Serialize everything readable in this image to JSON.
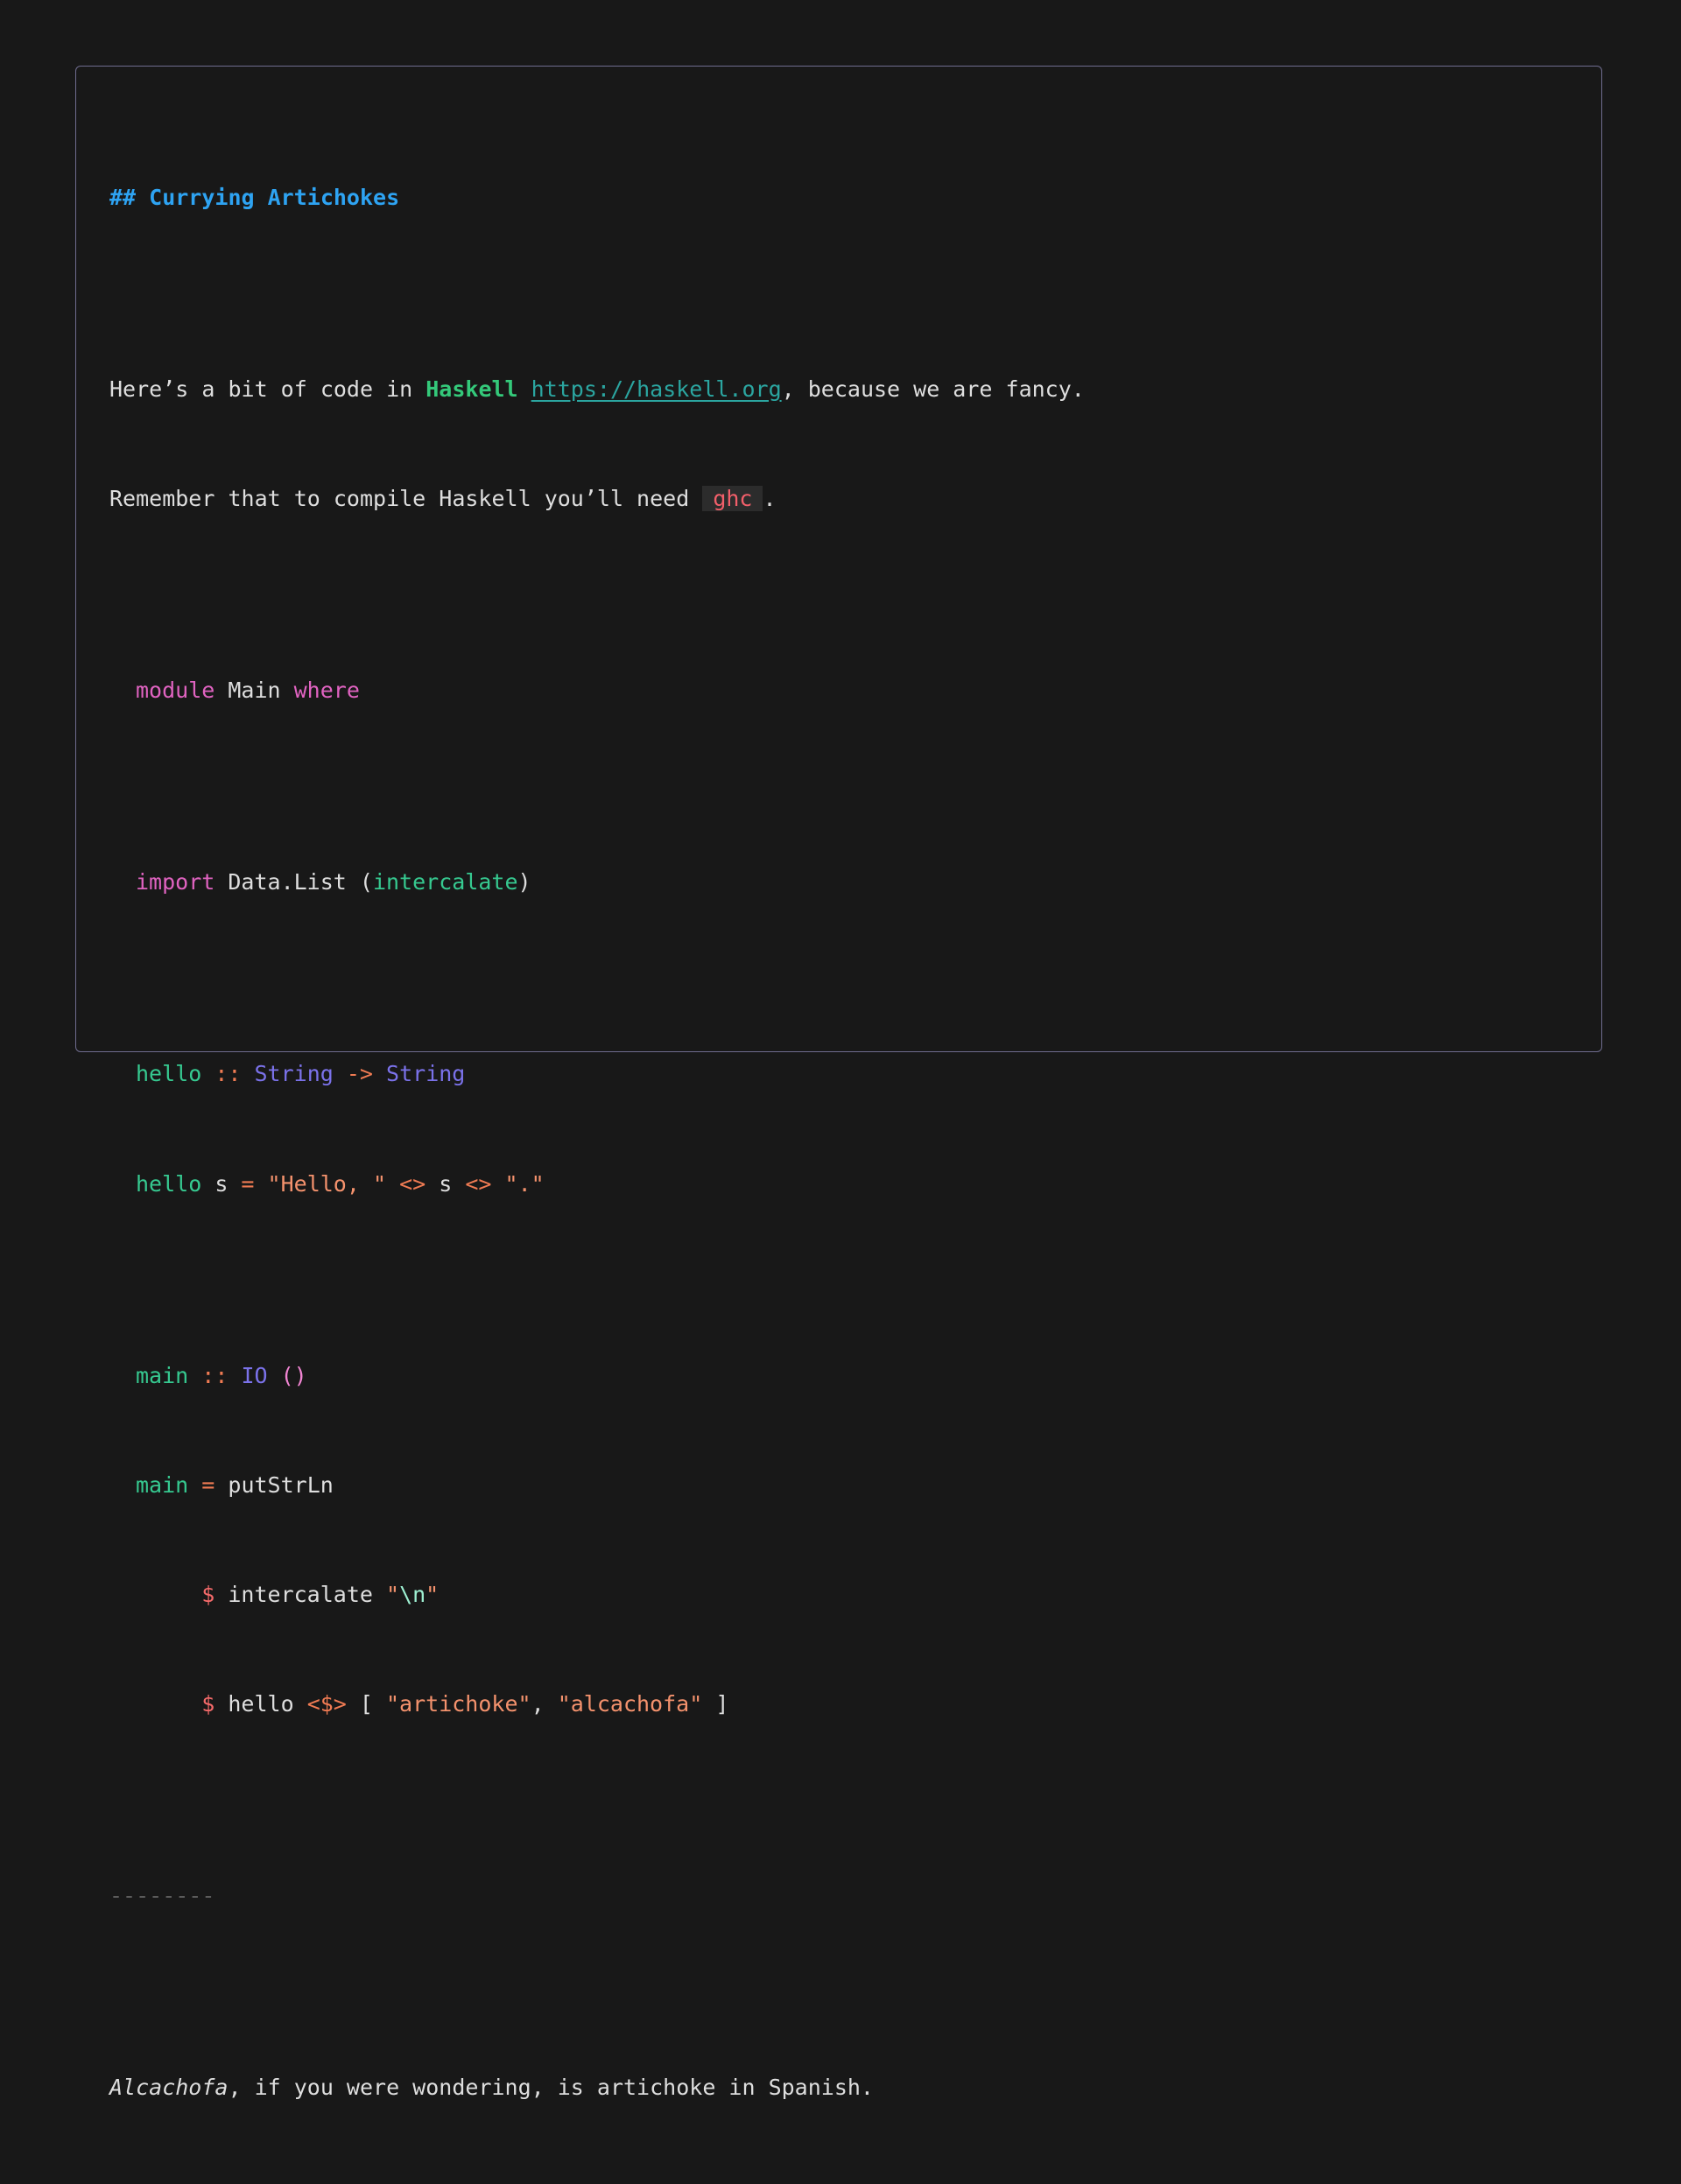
{
  "document": {
    "heading": "## Currying Artichokes",
    "intro": {
      "prefix": "Here’s a bit of code in ",
      "bold": "Haskell",
      "space": " ",
      "link": "https://haskell.org",
      "suffix": ", because we are fancy."
    },
    "intro2": {
      "prefix": "Remember that to compile Haskell you’ll need ",
      "code": "ghc",
      "suffix": "."
    },
    "code": {
      "l1": {
        "a": "module",
        "b": " Main ",
        "c": "where"
      },
      "l2": {
        "a": "import",
        "b": " Data.List (",
        "c": "intercalate",
        "d": ")"
      },
      "l3": {
        "a": "hello",
        "b": " ",
        "c": "::",
        "d": " ",
        "e": "String",
        "f": " ",
        "g": "->",
        "h": " ",
        "i": "String"
      },
      "l4": {
        "a": "hello",
        "b": " s ",
        "c": "=",
        "d": " ",
        "e": "\"Hello, \"",
        "f": " ",
        "g": "<>",
        "h": " s ",
        "i": "<>",
        "j": " ",
        "k": "\".\""
      },
      "l5": {
        "a": "main",
        "b": " ",
        "c": "::",
        "d": " ",
        "e": "IO",
        "f": " ",
        "g": "()"
      },
      "l6": {
        "a": "main",
        "b": " ",
        "c": "=",
        "d": " putStrLn"
      },
      "l7": {
        "indent": "     ",
        "a": "$",
        "b": " intercalate ",
        "c": "\"",
        "d": "\\n",
        "e": "\""
      },
      "l8": {
        "indent": "     ",
        "a": "$",
        "b": " hello ",
        "c": "<$>",
        "d": " [ ",
        "e": "\"artichoke\"",
        "f": ", ",
        "g": "\"alcachofa\"",
        "h": " ]"
      }
    },
    "rule": "--------",
    "outro": {
      "italic": "Alcachofa",
      "rest": ", if you were wondering, is artichoke in Spanish."
    }
  },
  "colors": {
    "background": "#181818",
    "border": "#6f6c8f",
    "heading": "#2ea3f2",
    "keyword": "#e063c1",
    "function": "#36c990",
    "type": "#7b72ea",
    "operator": "#f07b53",
    "string": "#f4926d",
    "inline_code": "#f25f6a"
  }
}
